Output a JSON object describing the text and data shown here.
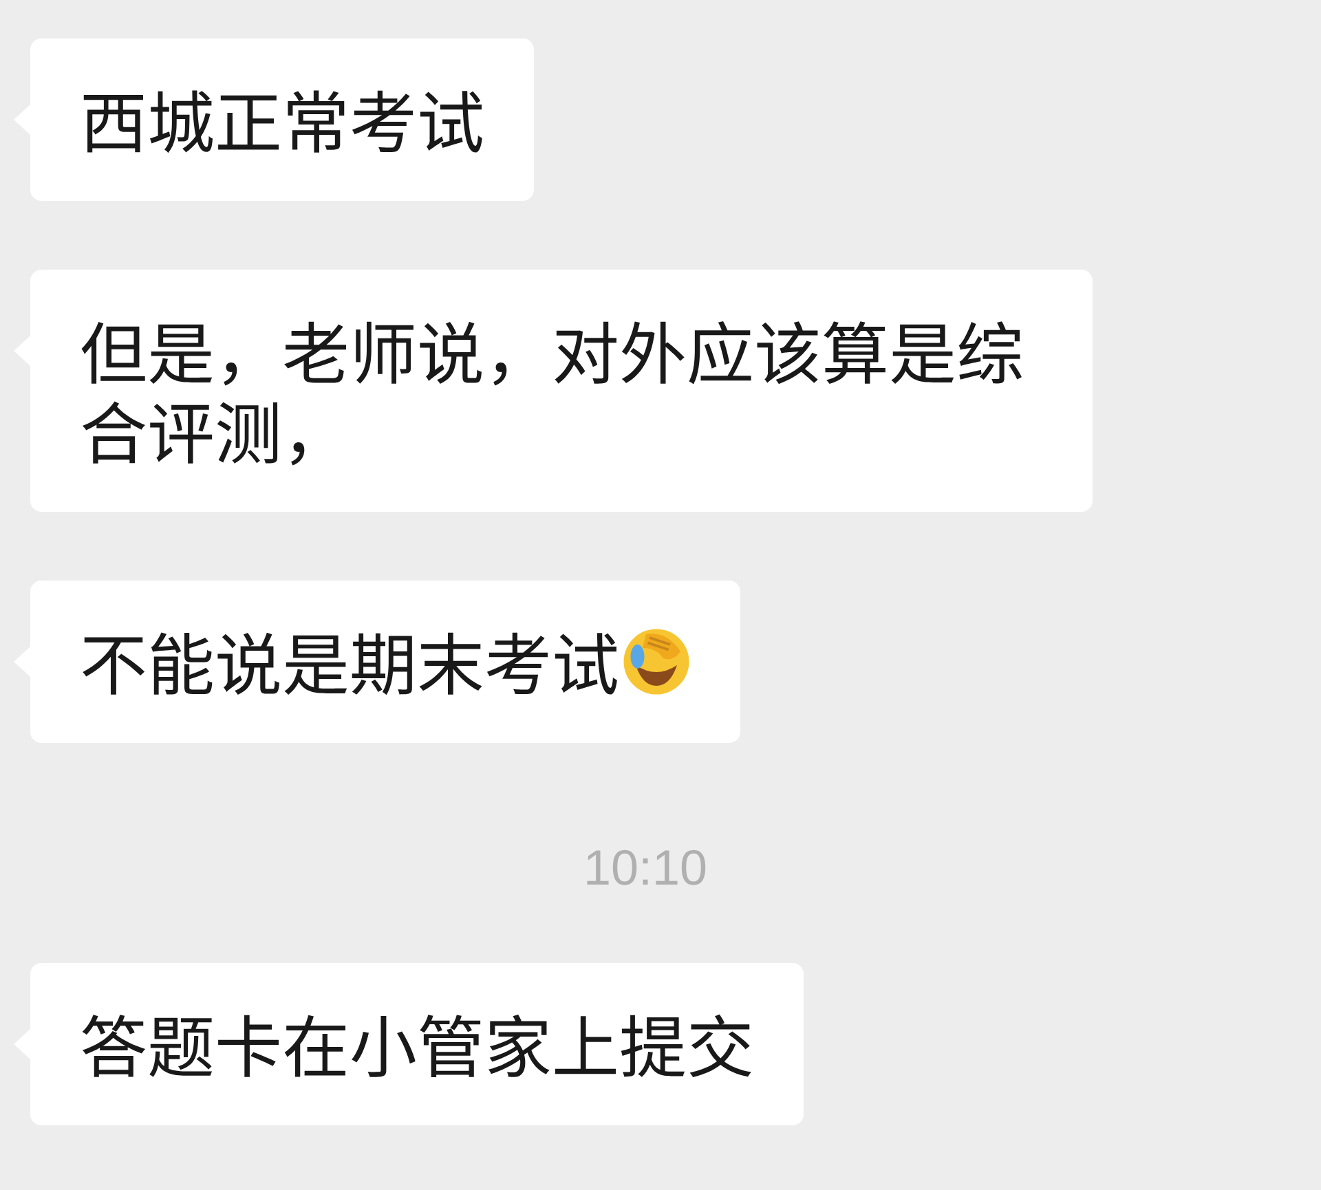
{
  "messages": [
    {
      "kind": "bubble",
      "text": "西城正常考试",
      "trailing_emoji": false
    },
    {
      "kind": "bubble",
      "text": "但是，老师说，对外应该算是综合评测，",
      "trailing_emoji": false
    },
    {
      "kind": "bubble",
      "text": "不能说是期末考试",
      "trailing_emoji": true
    },
    {
      "kind": "timestamp",
      "text": "10:10"
    },
    {
      "kind": "bubble",
      "text": "答题卡在小管家上提交",
      "trailing_emoji": false
    }
  ]
}
